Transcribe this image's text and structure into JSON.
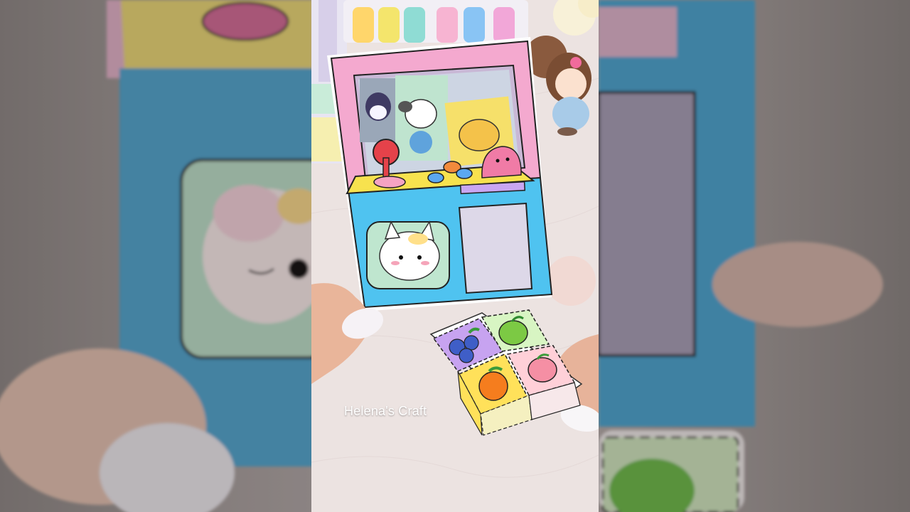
{
  "watermark": {
    "text": "Helena's Craft"
  },
  "scene": {
    "subject_icons": [
      "claw-machine-icon",
      "fruit-cube-icon",
      "cat-face-icon",
      "doll-icon",
      "highlighter-pens-icon"
    ],
    "colors": {
      "machine_pink": "#f4a9cf",
      "machine_blue": "#4fc3f0",
      "window_frame": "#e8b7d9",
      "cat_panel_green": "#bfe6cf",
      "fruit_blueberry_bg": "#c7a3f0",
      "fruit_apple_bg": "#d8f5c3",
      "fruit_orange_bg": "#ffe15a",
      "fruit_peach_bg": "#ffd0d8"
    }
  }
}
